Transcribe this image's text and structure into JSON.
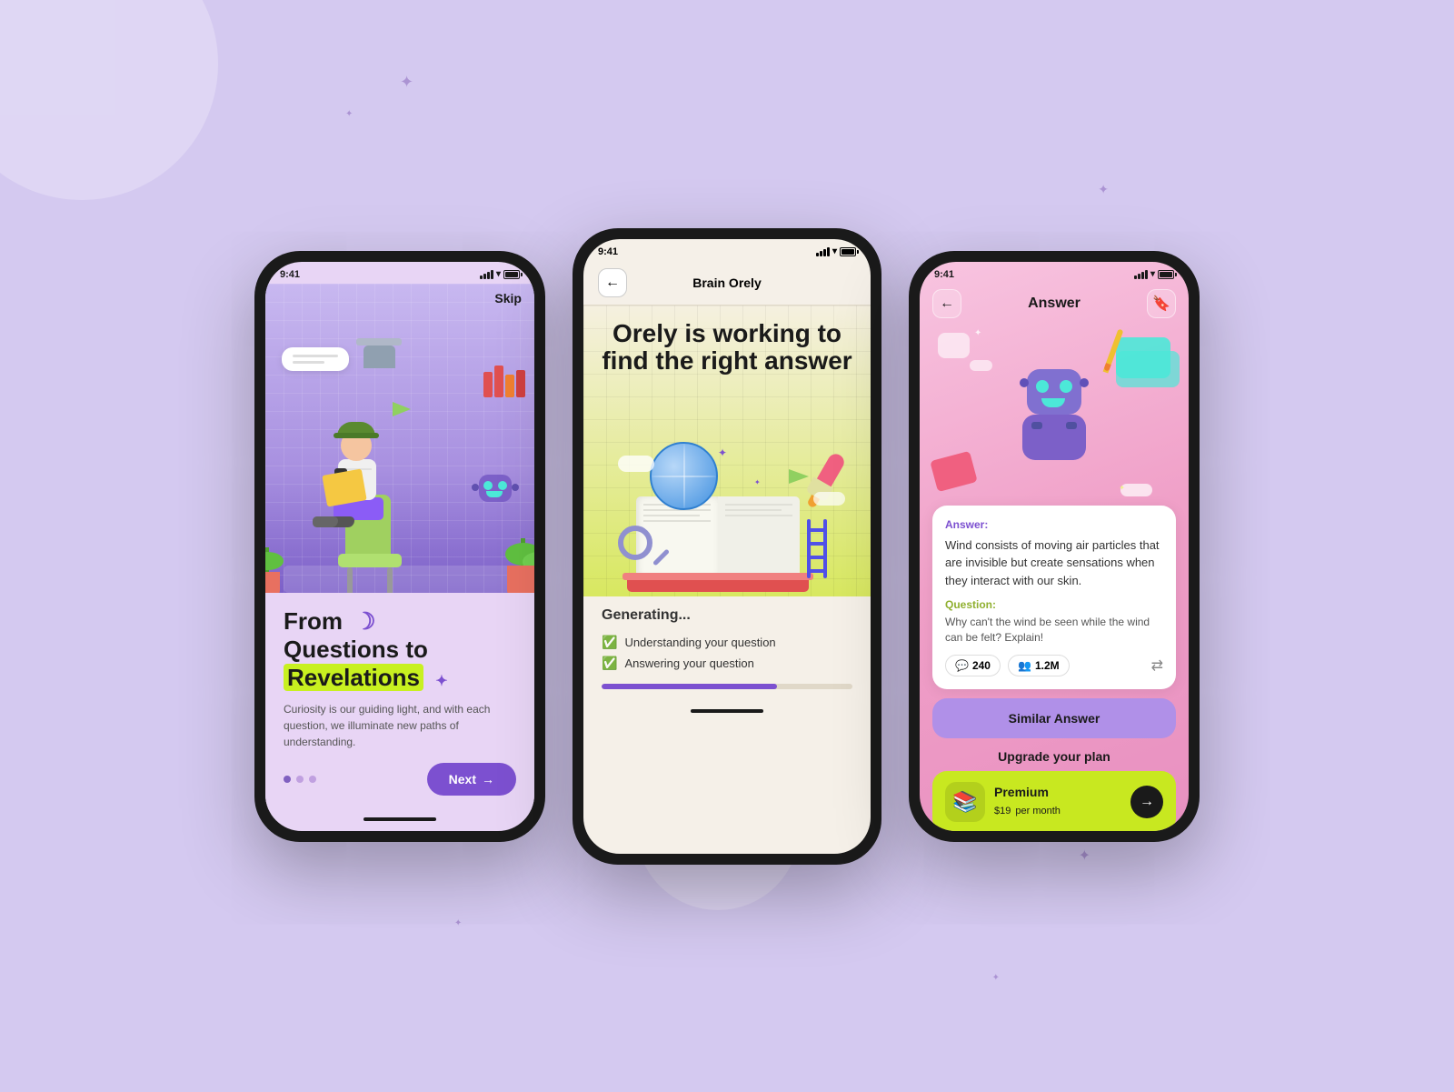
{
  "background": {
    "color": "#d4c9f0"
  },
  "phone1": {
    "status_time": "9:41",
    "skip_label": "Skip",
    "hero_title_line1": "From",
    "hero_title_line2": "Questions to",
    "hero_title_highlight": "Revelations",
    "description": "Curiosity is our guiding light, and with each question, we illuminate new paths of understanding.",
    "next_button": "Next →",
    "dots": [
      "active",
      "inactive",
      "inactive"
    ]
  },
  "phone2": {
    "status_time": "9:41",
    "header_title": "Brain Orely",
    "hero_title": "Orely is working to find the right answer",
    "generating_text": "Generating...",
    "check_items": [
      "Understanding your question",
      "Answering your question"
    ],
    "progress_percent": 70
  },
  "phone3": {
    "status_time": "9:41",
    "header_title": "Answer",
    "answer_label": "Answer:",
    "answer_text": "Wind consists of moving air particles that are invisible but create sensations when they interact with our skin.",
    "question_label": "Question:",
    "question_text": "Why can't the wind be seen while the wind can be felt? Explain!",
    "comments_count": "240",
    "users_count": "1.2M",
    "similar_answer_btn": "Similar Answer",
    "upgrade_label": "Upgrade your plan",
    "premium_name": "Premium",
    "premium_price": "$19",
    "premium_period": "per month"
  }
}
